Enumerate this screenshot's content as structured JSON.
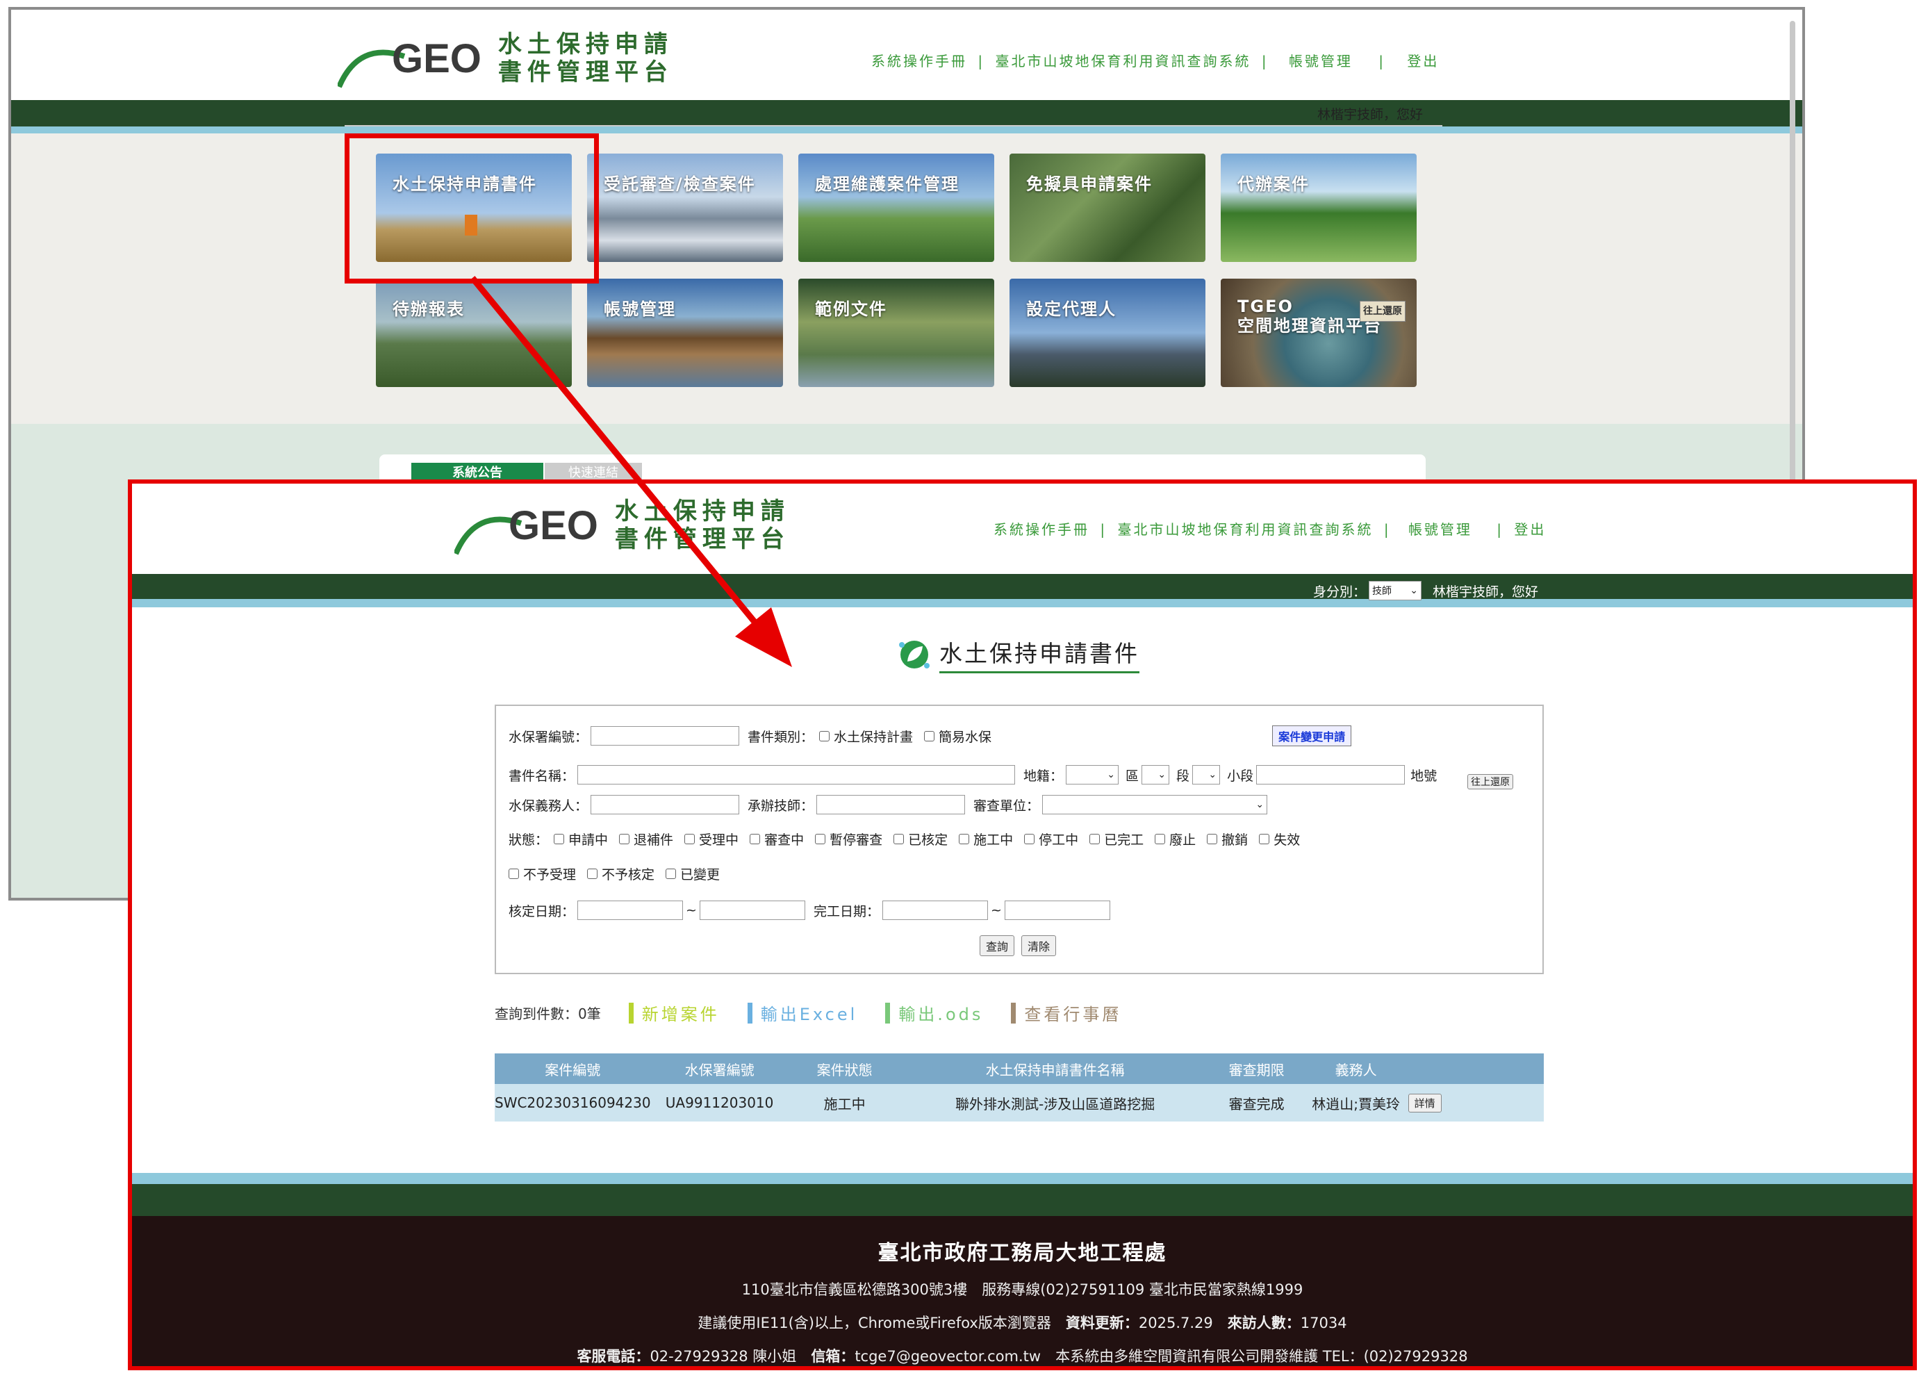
{
  "brand": {
    "geo": "GEO",
    "line1": "水土保持申請",
    "line2": "書件管理平台"
  },
  "toplinks": [
    "系統操作手冊",
    "|",
    "臺北市山坡地保育利用資訊查詢系統",
    "|",
    "帳號管理",
    "|",
    "登出"
  ],
  "user": {
    "greeting": "林楷宇技師，您好",
    "role_label": "身分別：",
    "role_value": "技師"
  },
  "tiles": [
    {
      "label": "水土保持申請書件"
    },
    {
      "label": "受託審查/檢查案件"
    },
    {
      "label": "處理維護案件管理"
    },
    {
      "label": "免擬具申請案件"
    },
    {
      "label": "代辦案件"
    },
    {
      "label": "待辦報表"
    },
    {
      "label": "帳號管理"
    },
    {
      "label": "範例文件"
    },
    {
      "label": "設定代理人"
    },
    {
      "label": "TGEO\n空間地理資訊平台",
      "badge": "往上還原"
    }
  ],
  "tabs": {
    "announce": "系統公告",
    "quicklinks": "快速連結"
  },
  "page_title": "水土保持申請書件",
  "form": {
    "swc_no": "水保署編號：",
    "doc_type": "書件類別：",
    "doc_types": [
      "水土保持計畫",
      "簡易水保"
    ],
    "change_btn": "案件變更申請",
    "doc_name": "書件名稱：",
    "land": "地籍：",
    "district": "區",
    "section": "段",
    "subsection": "小段",
    "landno": "地號",
    "restore_btn": "往上還原",
    "obligor": "水保義務人：",
    "engineer": "承辦技師：",
    "review_unit": "審查單位：",
    "status": "狀態：",
    "statuses1": [
      "申請中",
      "退補件",
      "受理中",
      "審查中",
      "暫停審查",
      "已核定",
      "施工中",
      "停工中",
      "已完工",
      "廢止",
      "撤銷",
      "失效"
    ],
    "statuses2": [
      "不予受理",
      "不予核定",
      "已變更"
    ],
    "approve_date": "核定日期：",
    "finish_date": "完工日期：",
    "tilde": "~",
    "search_btn": "查詢",
    "clear_btn": "清除"
  },
  "actions": {
    "count": "查詢到件數：0筆",
    "new": "新增案件",
    "excel": "輸出Excel",
    "ods": "輸出.ods",
    "calendar": "查看行事曆"
  },
  "colors": {
    "new": "#b8d430",
    "excel": "#6ab0e0",
    "ods": "#7ac87a",
    "calendar": "#a08a70"
  },
  "table": {
    "headers": [
      "案件編號",
      "水保署編號",
      "案件狀態",
      "水土保持申請書件名稱",
      "審查期限",
      "義務人",
      ""
    ],
    "rows": [
      [
        "SWC20230316094230",
        "UA9911203010",
        "施工中",
        "聯外排水測試-涉及山區道路挖掘",
        "審查完成",
        "林逍山;賈美玲",
        "詳情"
      ]
    ]
  },
  "footer": {
    "title": "臺北市政府工務局大地工程處",
    "line1": "110臺北市信義區松德路300號3樓　服務專線(02)27591109 臺北市民當家熱線1999",
    "line2a": "建議使用IE11(含)以上，Chrome或Firefox版本瀏覽器　",
    "line2b": "資料更新：",
    "line2c": "2025.7.29　",
    "line2d": "來訪人數：",
    "line2e": "17034",
    "line3a": "客服電話：",
    "line3b": "02-27929328 陳小姐　",
    "line3c": "信箱：",
    "line3d": "tcge7@geovector.com.tw　本系統由多維空間資訊有限公司開發維護 TEL：(02)27929328"
  }
}
